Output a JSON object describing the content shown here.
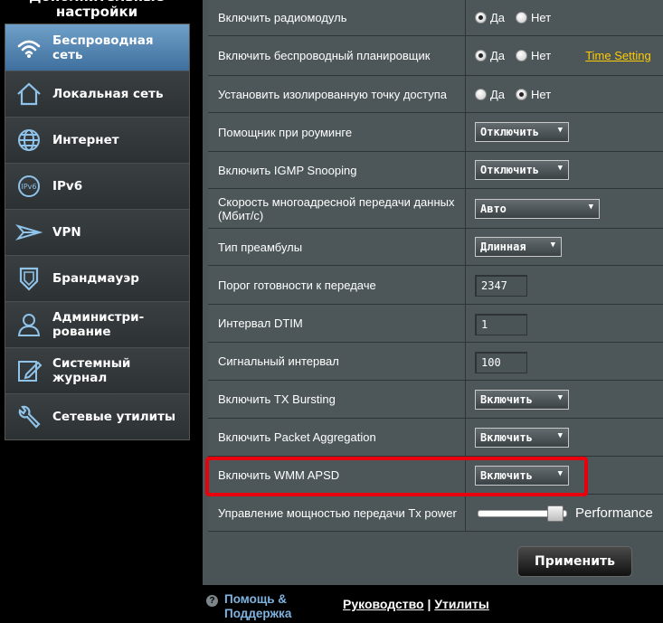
{
  "sidebar": {
    "header": "Дополнительные\nнастройки",
    "items": [
      {
        "label": "Беспроводная\nсеть",
        "icon": "wifi-icon",
        "active": true
      },
      {
        "label": "Локальная сеть",
        "icon": "home-icon"
      },
      {
        "label": "Интернет",
        "icon": "globe-icon"
      },
      {
        "label": "IPv6",
        "icon": "ipv6-icon"
      },
      {
        "label": "VPN",
        "icon": "vpn-icon"
      },
      {
        "label": "Брандмауэр",
        "icon": "shield-icon"
      },
      {
        "label": "Администри-\nрование",
        "icon": "admin-user-icon"
      },
      {
        "label": "Системный\nжурнал",
        "icon": "log-edit-icon"
      },
      {
        "label": "Сетевые утилиты",
        "icon": "tools-icon"
      }
    ]
  },
  "settings": {
    "radio_module": {
      "label": "Включить радиомодуль",
      "yes": "Да",
      "no": "Нет",
      "selected": "yes"
    },
    "scheduler": {
      "label": "Включить беспроводный планировщик",
      "yes": "Да",
      "no": "Нет",
      "selected": "yes",
      "link": "Time Setting"
    },
    "ap_isolated": {
      "label": "Установить изолированную точку доступа",
      "yes": "Да",
      "no": "Нет",
      "selected": "no"
    },
    "roaming": {
      "label": "Помощник при роуминге",
      "value": "Отключить"
    },
    "igmp": {
      "label": "Включить IGMP Snooping",
      "value": "Отключить"
    },
    "multicast_rate": {
      "label": "Скорость многоадресной передачи данных (Мбит/с)",
      "value": "Авто"
    },
    "preamble": {
      "label": "Тип преамбулы",
      "value": "Длинная"
    },
    "rts": {
      "label": "Порог готовности к передаче",
      "value": "2347"
    },
    "dtim": {
      "label": "Интервал DTIM",
      "value": "1"
    },
    "beacon": {
      "label": "Сигнальный интервал",
      "value": "100"
    },
    "tx_bursting": {
      "label": "Включить TX Bursting",
      "value": "Включить"
    },
    "packet_aggregation": {
      "label": "Включить Packet Aggregation",
      "value": "Включить"
    },
    "wmm_apsd": {
      "label": "Включить WMM APSD",
      "value": "Включить"
    },
    "tx_power": {
      "label": "Управление мощностью передачи Tx power",
      "value_text": "Performance",
      "level": 0.9
    }
  },
  "apply_label": "Применить",
  "footer": {
    "help": "Помощь &\nПоддержка",
    "manual": "Руководство",
    "separator": " | ",
    "utilities": "Утилиты"
  },
  "colors": {
    "highlight": "#e8000c",
    "link": "#ffcc00",
    "active_menu": "#4f82b1"
  }
}
